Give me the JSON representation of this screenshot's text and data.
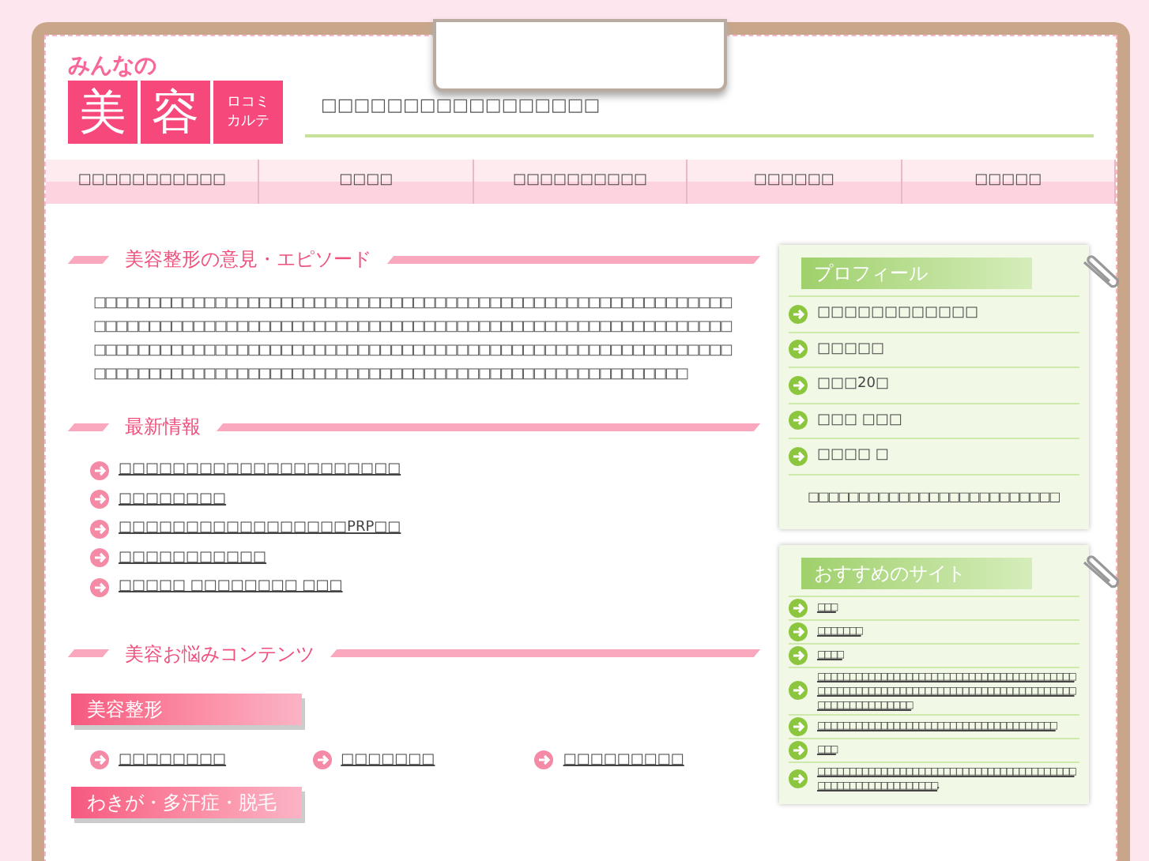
{
  "logo": {
    "small": "みんなの",
    "big": [
      "美",
      "容"
    ],
    "side": [
      "ロコミ",
      "カルテ"
    ]
  },
  "site_description": "□□□□□□□□□□□□□□□□□",
  "nav": [
    {
      "label": "□□□□□□□□□□□"
    },
    {
      "label": "□□□□"
    },
    {
      "label": "□□□□□□□□□□"
    },
    {
      "label": "□□□□□□"
    },
    {
      "label": "□□□□□"
    }
  ],
  "episode": {
    "heading": "美容整形の意見・エピソード",
    "text": "□□□□□□□□□□□□□□□□□□□□□□□□□□□□□□□□□□□□□□□□□□□□□□□□□□□□□□□□□□□□□□□□□□□□□□□□□□□□□□□□□□□□□□□□□□□□□□□□□□□□□□□□□□□□□□□□□□□□□□□□□□□□□□□□□□□□□□□□□□□□□□□□□□□□□□□□□□□□□□□□□□□□□□□□□□□□□□□□□□□□□□□□□□□□□□□□□□□□□□□□□□□□□□□□□□□□□□□□□□□□□□□□□□□□"
  },
  "news": {
    "heading": "最新情報",
    "items": [
      "□□□□□□□□□□□□□□□□□□□□□",
      "□□□□□□□□",
      "□□□□□□□□□□□□□□□□□PRP□□",
      "□□□□□□□□□□□",
      "□□□□□ □□□□□□□□ □□□"
    ]
  },
  "contents": {
    "heading": "美容お悩みコンテンツ",
    "categories": [
      {
        "title": "美容整形",
        "links": [
          "□□□□□□□□",
          "□□□□□□□",
          "□□□□□□□□□"
        ]
      },
      {
        "title": "わきが・多汗症・脱毛"
      }
    ]
  },
  "profile": {
    "heading": "プロフィール",
    "items": [
      "□□□□□□□□□□□□",
      "□□□□□",
      "□□□20□",
      "□□□ □□□",
      "□□□□ □"
    ],
    "note": "□□□□□□□□□□□□□□□□□□□□□□□□□"
  },
  "sites": {
    "heading": "おすすめのサイト",
    "items": [
      "□□□",
      "□□□□□□□",
      "□□□□",
      "□□□□□□□□□□□□□□□□□□□□□□□□□□□□□□□□□□□□□□□□□□□□□□□□□□□□□□□□□□□□□□□□□□□□□□□□□□□□□□□□□□□□□□□□□□□□□□□□□",
      "□□□□□□□□□□□□□□□□□□□□□□□□□□□□□□□□□□□□□□",
      "□□□",
      "□□□□□□□□□□□□□□□□□□□□□□□□□□□□□□□□□□□□□□□□□□□□□□□□□□□□□□□□□□□□..."
    ]
  }
}
